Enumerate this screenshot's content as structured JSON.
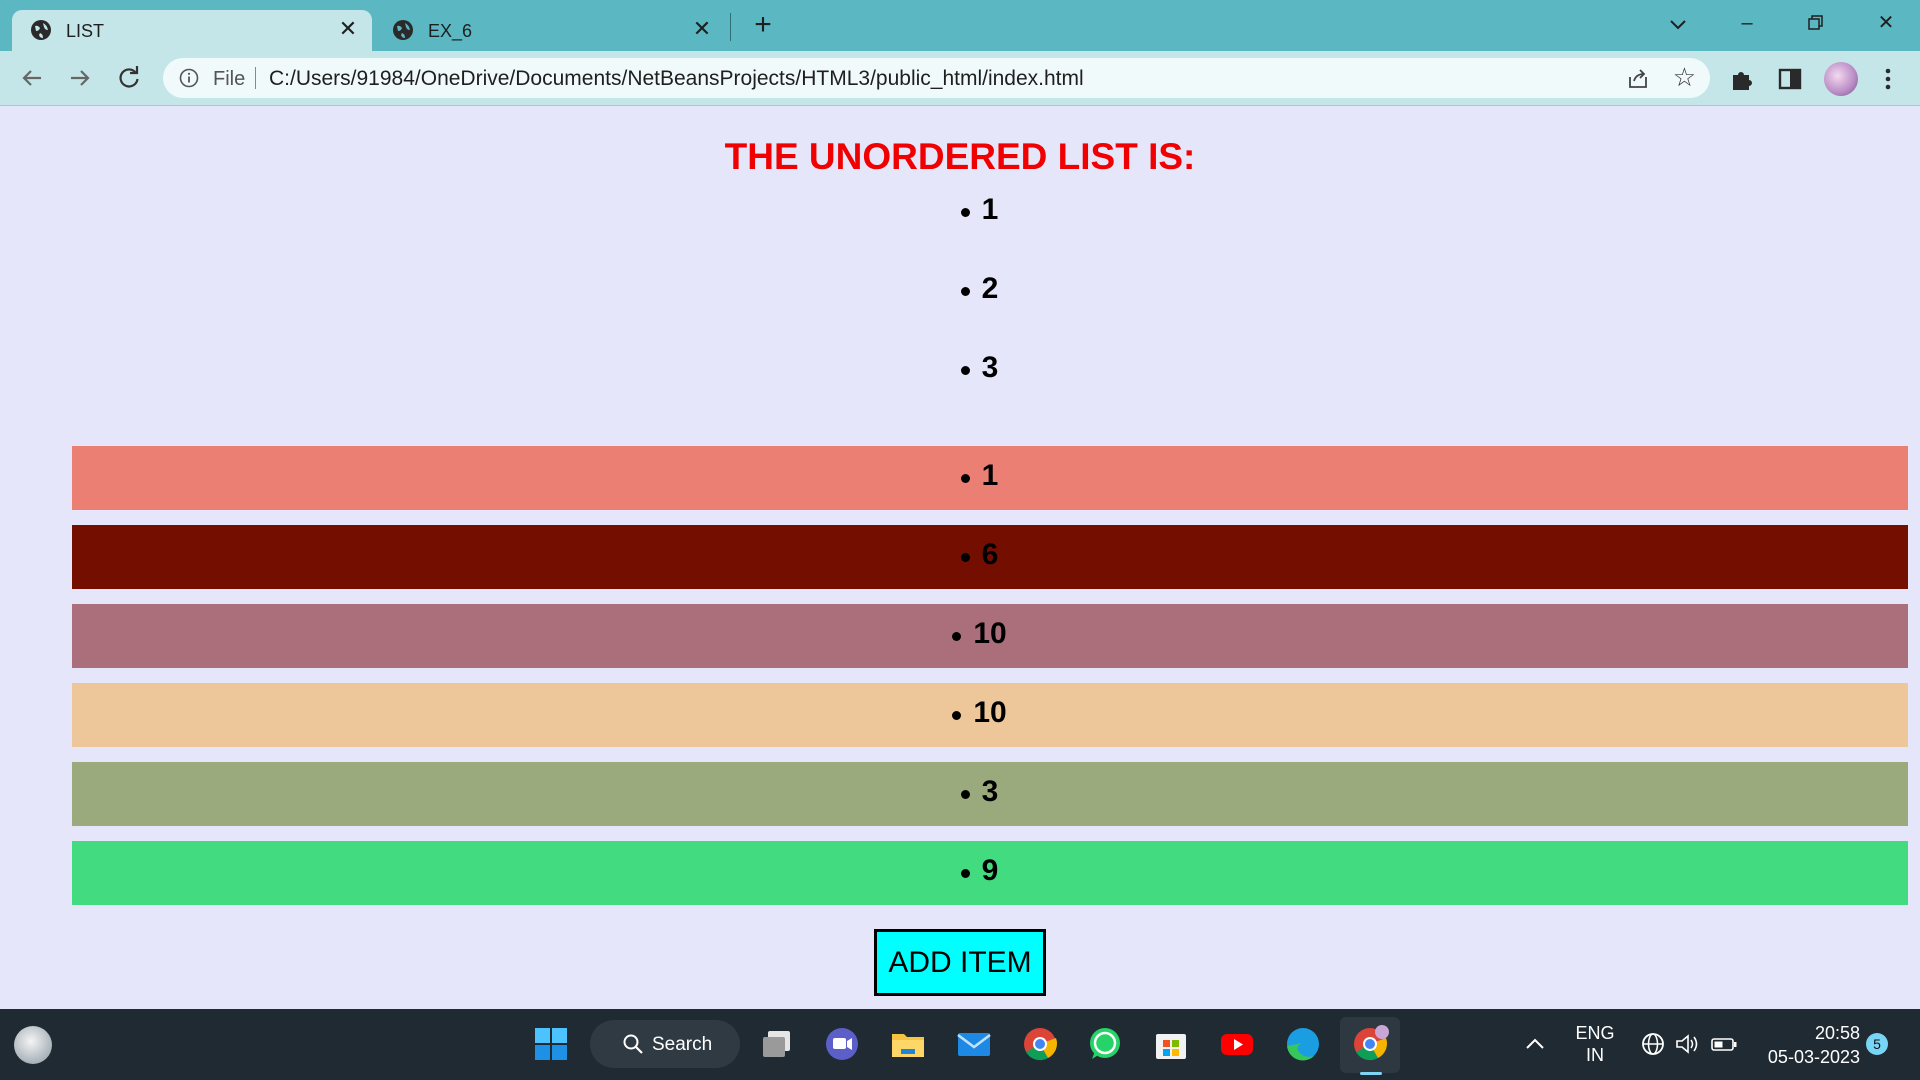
{
  "browser": {
    "tabs": [
      {
        "title": "LIST",
        "active": true
      },
      {
        "title": "EX_6",
        "active": false
      }
    ],
    "address": {
      "scheme_label": "File",
      "url": "C:/Users/91984/OneDrive/Documents/NetBeansProjects/HTML3/public_html/index.html"
    }
  },
  "page": {
    "heading": "THE UNORDERED LIST IS:",
    "plain_items": [
      "1",
      "2",
      "3"
    ],
    "colored_items": [
      {
        "value": "1",
        "color": "#ec7f73"
      },
      {
        "value": "6",
        "color": "#730e00"
      },
      {
        "value": "10",
        "color": "#ab6e7b"
      },
      {
        "value": "10",
        "color": "#edc799"
      },
      {
        "value": "3",
        "color": "#9aaa7c"
      },
      {
        "value": "9",
        "color": "#42db7f"
      }
    ],
    "add_button": "ADD ITEM"
  },
  "taskbar": {
    "search_label": "Search",
    "language": {
      "line1": "ENG",
      "line2": "IN"
    },
    "time": "20:58",
    "date": "05-03-2023",
    "notification_count": "5"
  },
  "colors": {
    "page_background": "#e6e6fa",
    "heading": "#f00000",
    "button": "#00ffff",
    "tabbar": "#5bb8c2"
  }
}
